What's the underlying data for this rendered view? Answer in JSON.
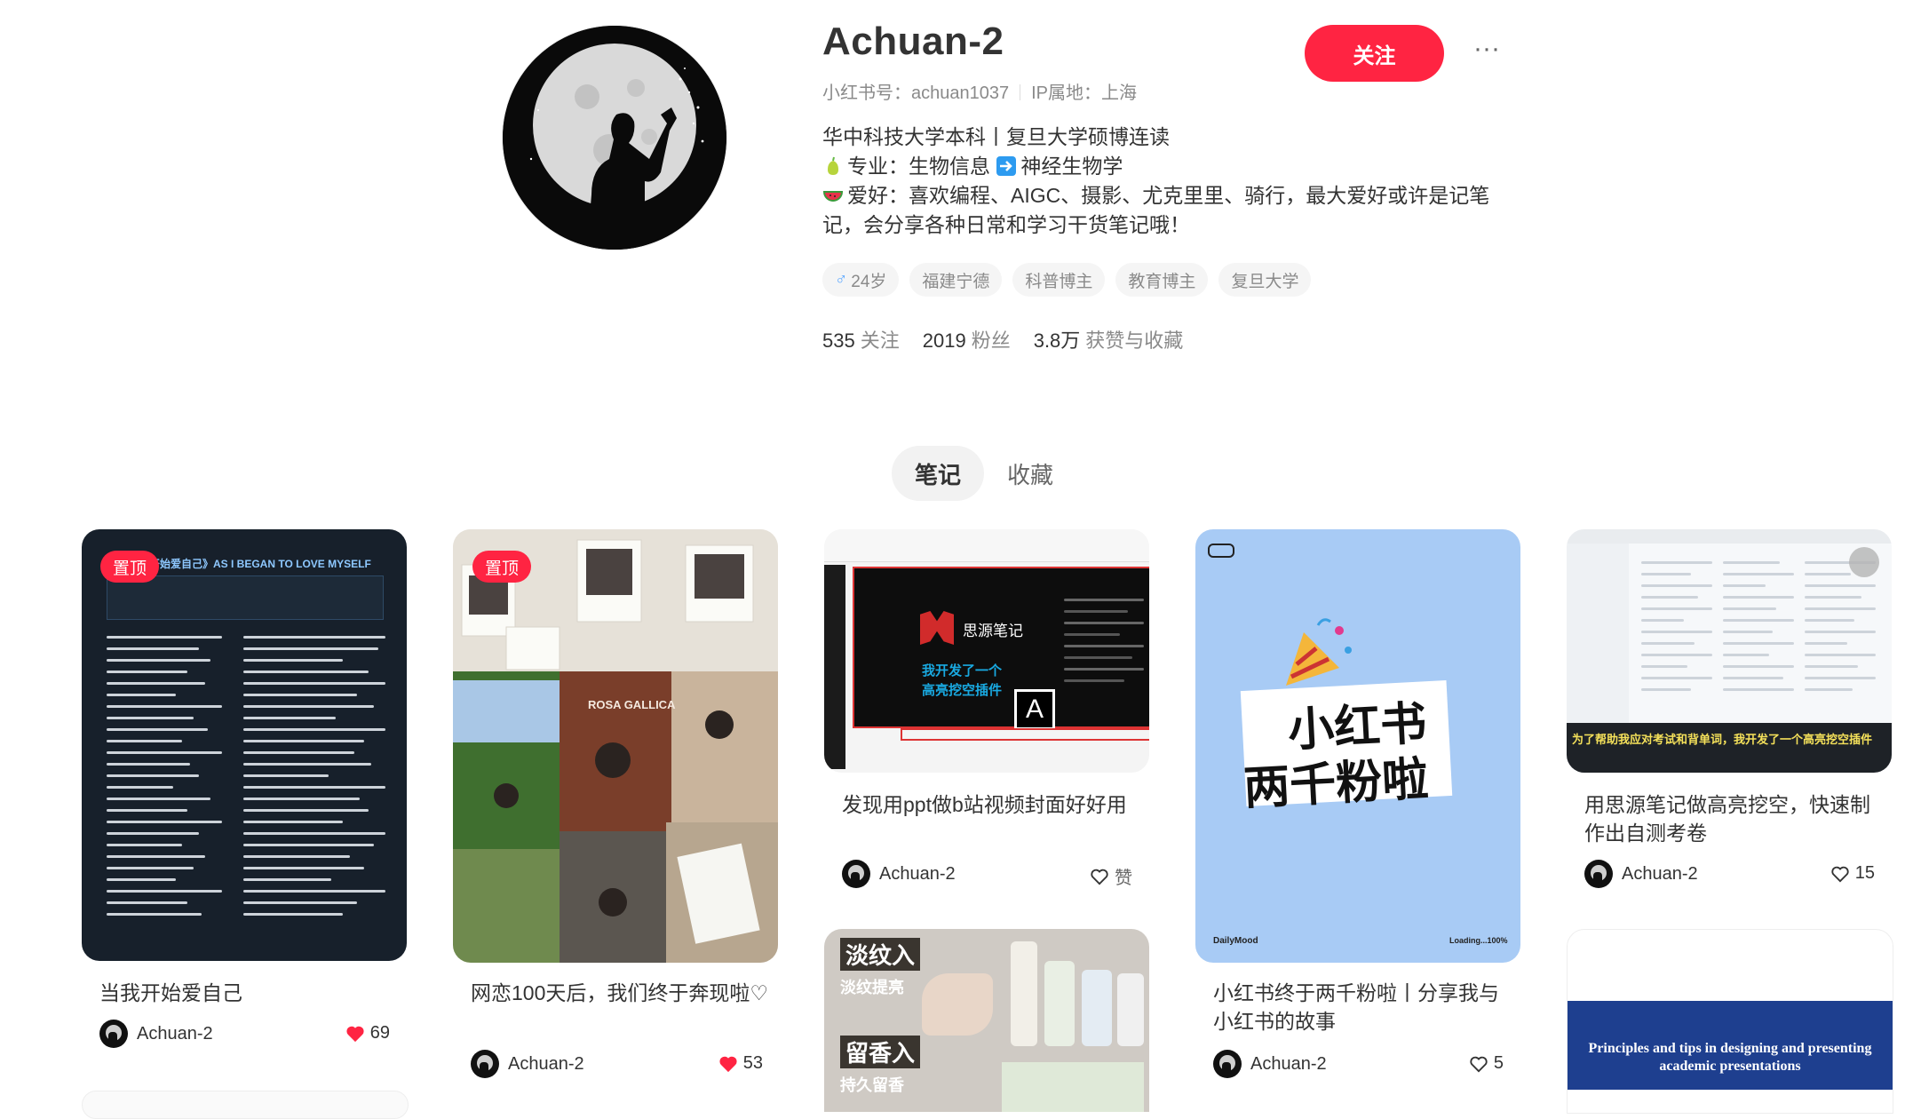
{
  "profile": {
    "username": "Achuan-2",
    "account_id": "小红书号：achuan1037",
    "ip_location": "IP属地：上海",
    "follow_label": "关注",
    "more_label": "···",
    "bio_line1": "华中科技大学本科丨复旦大学硕博连读",
    "bio_line2": "专业：生物信息",
    "bio_line2b": "神经生物学",
    "bio_line3": "爱好：喜欢编程、AIGC、摄影、尤克里里、骑行，最大爱好或许是记笔记，会分享各种日常和学习干货笔记哦！",
    "tags": [
      "24岁",
      "福建宁德",
      "科普博主",
      "教育博主",
      "复旦大学"
    ],
    "gender_icon": "♂",
    "stats": [
      {
        "value": "535",
        "label": "关注"
      },
      {
        "value": "2019",
        "label": "粉丝"
      },
      {
        "value": "3.8万",
        "label": "获赞与收藏"
      }
    ]
  },
  "tabs": [
    {
      "label": "笔记",
      "active": true
    },
    {
      "label": "收藏",
      "active": false
    }
  ],
  "notes": [
    {
      "title": "当我开始爱自己",
      "author": "Achuan-2",
      "likes": "69",
      "liked": true,
      "pinned": true,
      "pin_label": "置顶",
      "cover_heading": "《当我开始爱自己》AS I BEGAN TO LOVE MYSELF"
    },
    {
      "title": "网恋100天后，我们终于奔现啦♡",
      "author": "Achuan-2",
      "likes": "53",
      "liked": true,
      "pinned": true,
      "pin_label": "置顶",
      "cover_text": "ROSA GALLICA"
    },
    {
      "title": "发现用ppt做b站视频封面好好用",
      "author": "Achuan-2",
      "likes": "赞",
      "liked": false,
      "pinned": false,
      "cover_brand": "思源笔记",
      "cover_line1": "我开发了一个",
      "cover_line2": "高亮挖空插件",
      "cover_glyph": "A"
    },
    {
      "title": "小红书终于两千粉啦丨分享我与小红书的故事",
      "author": "Achuan-2",
      "likes": "5",
      "liked": false,
      "pinned": false,
      "cover_line1": "小红书",
      "cover_line2": "两千粉啦",
      "cover_footer_left": "DailyMood",
      "cover_footer_right": "Loading...100%"
    },
    {
      "title": "用思源笔记做高亮挖空，快速制作出自测考卷",
      "author": "Achuan-2",
      "likes": "15",
      "liked": false,
      "pinned": false,
      "cover_caption": "为了帮助我应对考试和背单词，我开发了一个高亮挖空插件"
    },
    {
      "title": "",
      "author": "",
      "likes": "",
      "pinned": false,
      "cover_l1": "淡纹入",
      "cover_l2": "淡纹提亮",
      "cover_l3": "留香入",
      "cover_l4": "持久留香"
    },
    {
      "title": "",
      "author": "",
      "likes": "",
      "pinned": false,
      "cover_text": "Principles and tips in designing and presenting academic presentations"
    }
  ],
  "colors": {
    "accent": "#ff2442",
    "muted": "#8a8a8a"
  }
}
